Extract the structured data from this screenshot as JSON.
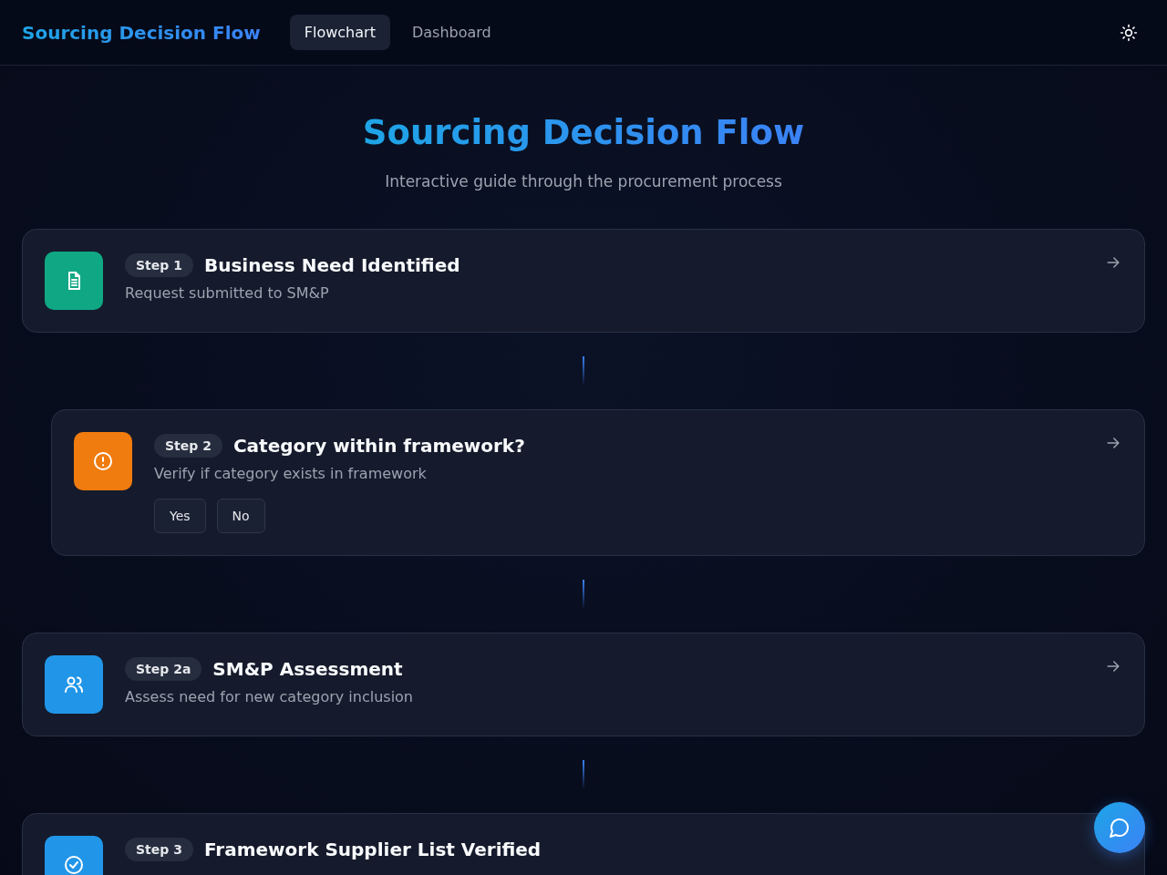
{
  "header": {
    "brand": "Sourcing Decision Flow",
    "tabs": [
      {
        "label": "Flowchart",
        "selected": true
      },
      {
        "label": "Dashboard",
        "selected": false
      }
    ]
  },
  "hero": {
    "title": "Sourcing Decision Flow",
    "subtitle": "Interactive guide through the procurement process"
  },
  "steps": [
    {
      "kind": "request",
      "color": "#10a884",
      "badge": "Step 1",
      "title": "Business Need Identified",
      "description": "Request submitted to SM&P"
    },
    {
      "kind": "decision",
      "color": "#f07b0e",
      "badge": "Step 2",
      "title": "Category within framework?",
      "description": "Verify if category exists in framework",
      "options": [
        "Yes",
        "No"
      ]
    },
    {
      "kind": "assessment",
      "color": "#2196e8",
      "badge": "Step 2a",
      "title": "SM&P Assessment",
      "description": "Assess need for new category inclusion"
    },
    {
      "kind": "verification",
      "color": "#2196e8",
      "badge": "Step 3",
      "title": "Framework Supplier List Verified"
    }
  ]
}
